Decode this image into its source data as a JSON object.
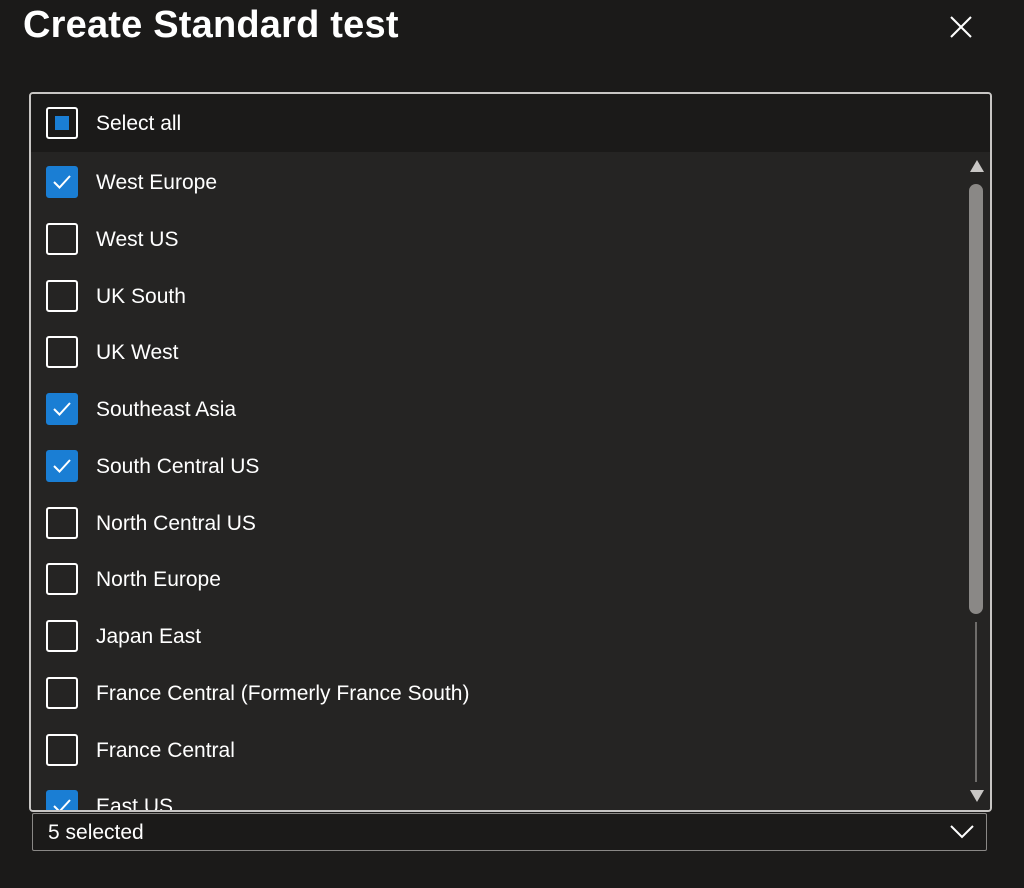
{
  "dialog": {
    "title": "Create Standard test"
  },
  "select_all": {
    "label": "Select all",
    "state": "indeterminate"
  },
  "options": [
    {
      "label": "West Europe",
      "checked": true
    },
    {
      "label": "West US",
      "checked": false
    },
    {
      "label": "UK South",
      "checked": false
    },
    {
      "label": "UK West",
      "checked": false
    },
    {
      "label": "Southeast Asia",
      "checked": true
    },
    {
      "label": "South Central US",
      "checked": true
    },
    {
      "label": "North Central US",
      "checked": false
    },
    {
      "label": "North Europe",
      "checked": false
    },
    {
      "label": "Japan East",
      "checked": false
    },
    {
      "label": "France Central (Formerly France South)",
      "checked": false
    },
    {
      "label": "France Central",
      "checked": false
    },
    {
      "label": "East US",
      "checked": true
    }
  ],
  "combo": {
    "value": "5 selected"
  },
  "colors": {
    "background": "#1b1a19",
    "list_background": "#252423",
    "accent": "#1a7ed4",
    "border": "#c8c6c4"
  },
  "icons": {
    "close": "close-icon",
    "check": "checkmark-icon",
    "chevron": "chevron-down-icon",
    "scroll_up": "triangle-up-icon",
    "scroll_down": "triangle-down-icon"
  }
}
